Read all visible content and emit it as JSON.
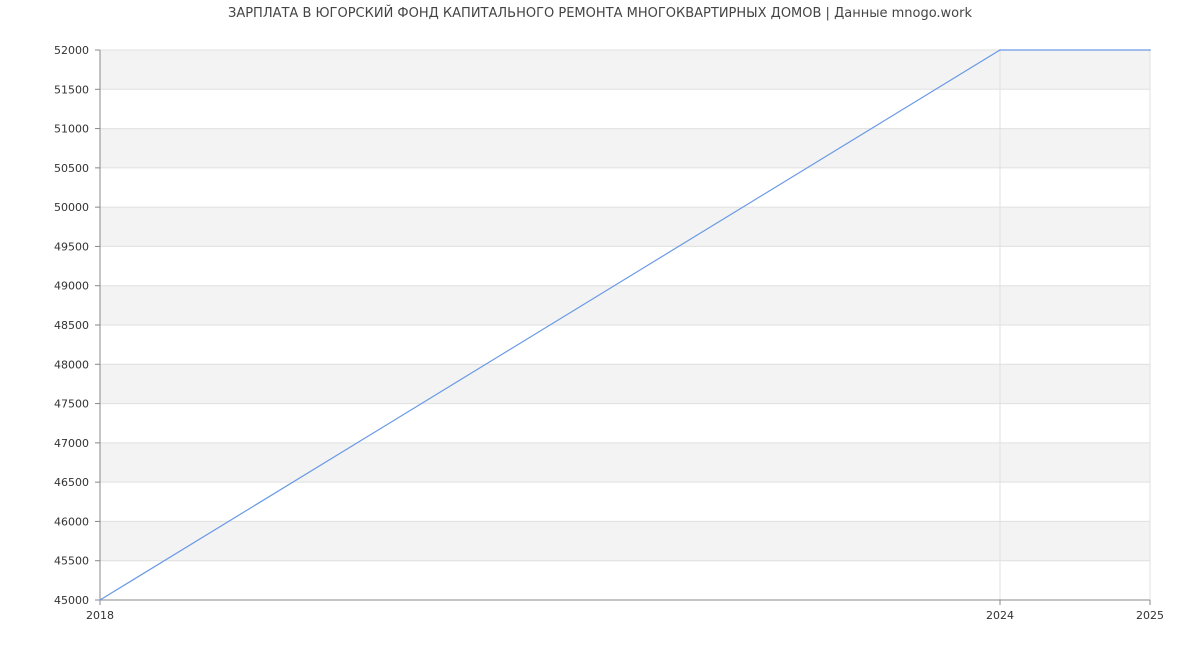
{
  "chart_data": {
    "type": "line",
    "title": "ЗАРПЛАТА В ЮГОРСКИЙ ФОНД КАПИТАЛЬНОГО РЕМОНТА МНОГОКВАРТИРНЫХ ДОМОВ | Данные mnogo.work",
    "xlabel": "",
    "ylabel": "",
    "x": [
      "2018",
      "2024",
      "2025"
    ],
    "series": [
      {
        "values": [
          45000,
          52000,
          52000
        ]
      }
    ],
    "ylim": [
      45000,
      52000
    ],
    "yticks": [
      "45000",
      "45500",
      "46000",
      "46500",
      "47000",
      "47500",
      "48000",
      "48500",
      "49000",
      "49500",
      "50000",
      "50500",
      "51000",
      "51500",
      "52000"
    ],
    "xticks": [
      "2018",
      "2024",
      "2025"
    ],
    "grid": true,
    "legend": "none",
    "colors": {
      "line": "#6a9ae6",
      "band": "#f3f3f3",
      "grid": "#e0e0e0",
      "axis": "#888888"
    }
  }
}
